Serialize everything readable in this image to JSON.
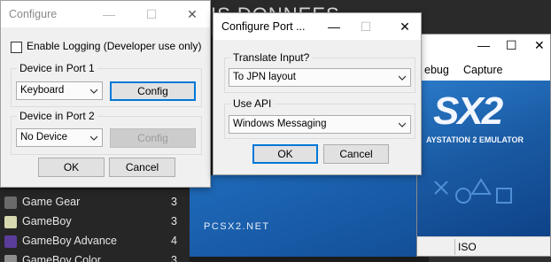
{
  "background": {
    "title": "IS DONNEES",
    "list": [
      {
        "label": "Game Gear",
        "count": "3",
        "icon_color": "#6a6a6a"
      },
      {
        "label": "GameBoy",
        "count": "3",
        "icon_color": "#d8d8b0"
      },
      {
        "label": "GameBoy Advance",
        "count": "4",
        "icon_color": "#5a3d9a"
      },
      {
        "label": "GameBoy Color",
        "count": "3",
        "icon_color": "#8e8e8e"
      }
    ]
  },
  "pcsx2": {
    "menu": [
      "ebug",
      "Capture"
    ],
    "logo": "SX2",
    "subtitle": "AYSTATION 2 EMULATOR",
    "site": "PCSX2.NET",
    "status": "ISO",
    "colors": {
      "splash": "#1a5ba4"
    }
  },
  "configure": {
    "title": "Configure",
    "enable_logging": "Enable Logging (Developer use only)",
    "port1": {
      "legend": "Device in Port 1",
      "value": "Keyboard",
      "config": "Config"
    },
    "port2": {
      "legend": "Device in Port 2",
      "value": "No Device",
      "config": "Config"
    },
    "ok": "OK",
    "cancel": "Cancel"
  },
  "configure_port": {
    "title": "Configure Port ...",
    "translate": {
      "legend": "Translate Input?",
      "value": "To JPN layout"
    },
    "api": {
      "legend": "Use API",
      "value": "Windows Messaging"
    },
    "ok": "OK",
    "cancel": "Cancel"
  },
  "colors": {
    "accent": "#0078d7",
    "dialog_bg": "#f0f0f0"
  }
}
